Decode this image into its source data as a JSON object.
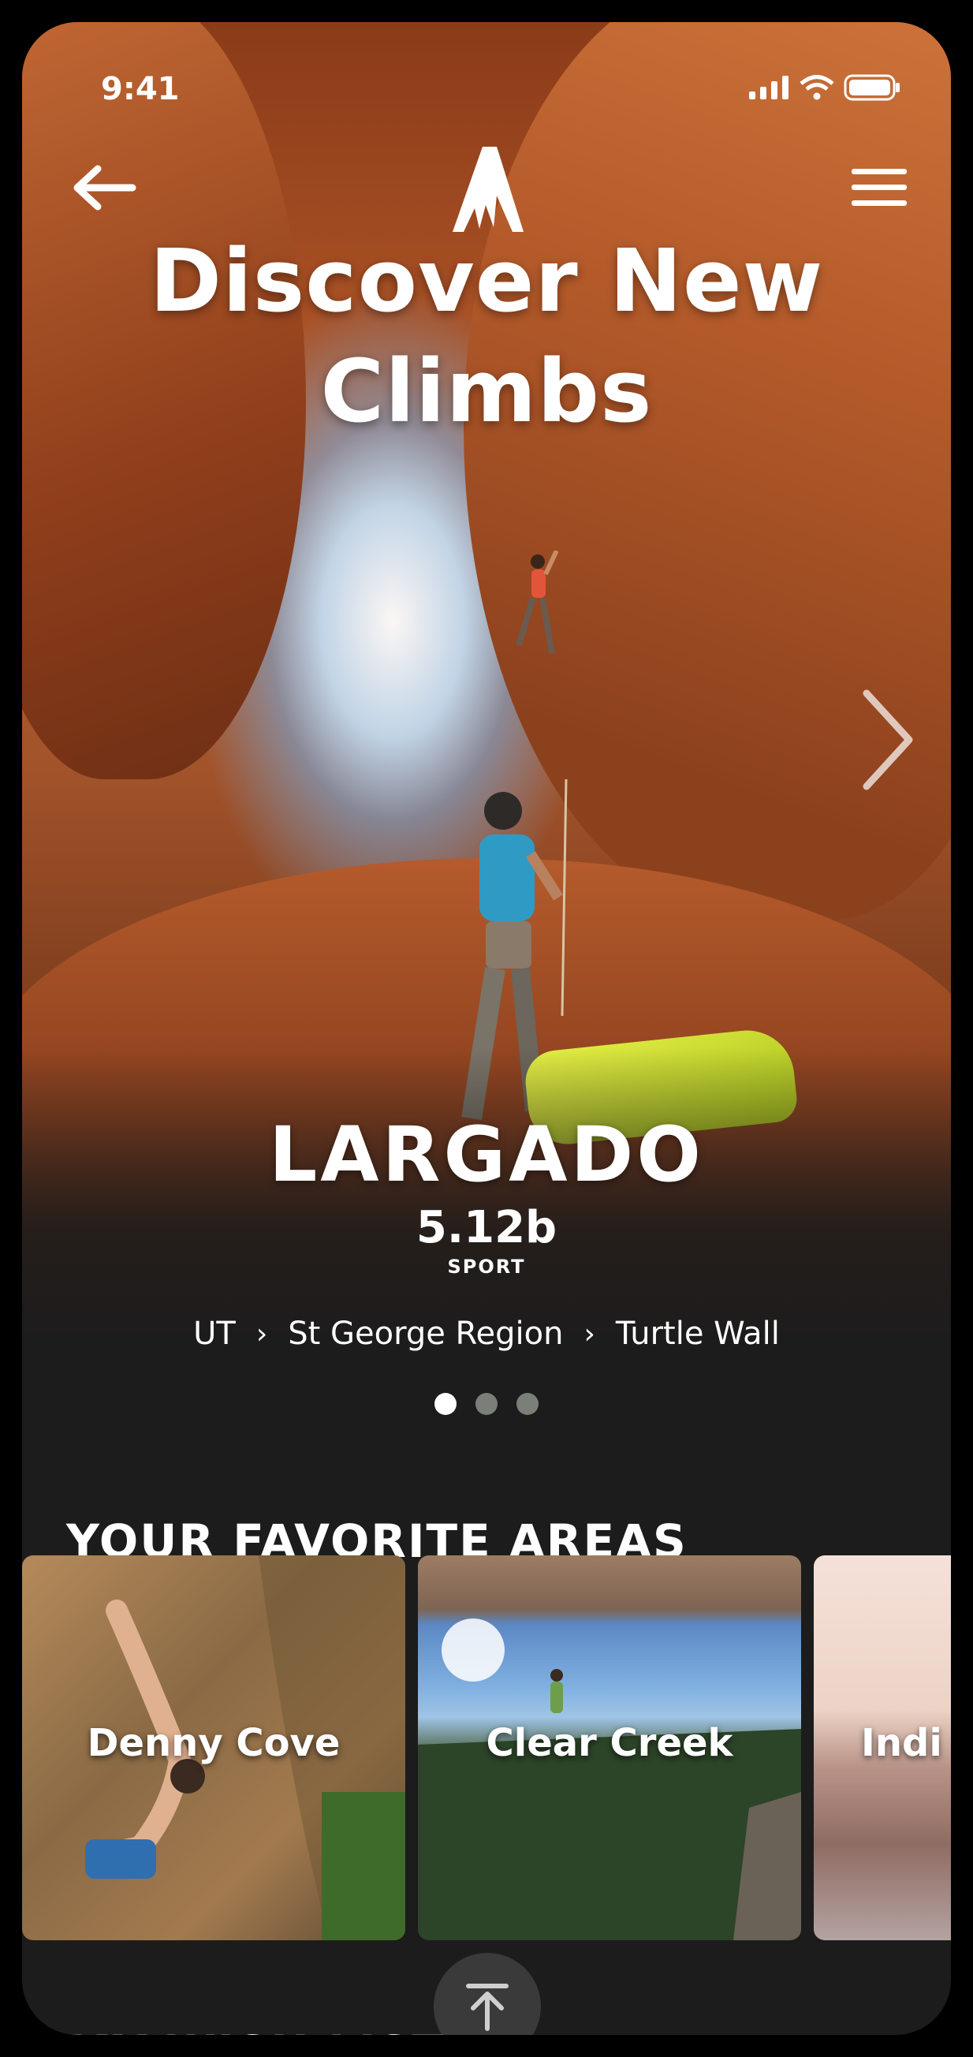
{
  "status_bar": {
    "time": "9:41"
  },
  "hero": {
    "title_line1": "Discover New",
    "title_line2": "Climbs",
    "route_name": "LARGADO",
    "route_grade": "5.12b",
    "route_type": "SPORT",
    "breadcrumb": [
      "UT",
      "St George Region",
      "Turtle Wall"
    ],
    "carousel": {
      "total": 3,
      "active_index": 0
    }
  },
  "favorites": {
    "title": "YOUR FAVORITE AREAS",
    "areas": [
      {
        "name": "Denny Cove"
      },
      {
        "name": "Clear Creek"
      },
      {
        "name": "Indi"
      }
    ]
  },
  "wishlist": {
    "title": "MY WISH LIST"
  },
  "icons": {
    "back": "arrow-left-icon",
    "menu": "hamburger-menu-icon",
    "next": "chevron-right-icon",
    "scroll_top": "arrow-up-to-top-icon"
  }
}
